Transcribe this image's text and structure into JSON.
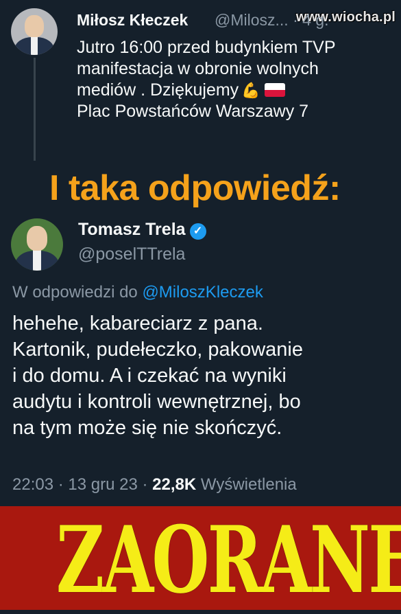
{
  "watermark": "www.wiocha.pl",
  "original_tweet": {
    "author_name": "Miłosz Kłeczek",
    "handle_truncated": "@Milosz... · 4 g.",
    "lines": [
      "Jutro 16:00 przed budynkiem TVP",
      "manifestacja w obronie wolnych",
      "mediów . Dziękujemy",
      "Plac Powstańców Warszawy 7"
    ],
    "emoji": "💪"
  },
  "overlay_heading": "I taka odpowiedź:",
  "reply_tweet": {
    "author_name": "Tomasz Trela",
    "verified_mark": "✓",
    "handle": "@poselTTrela",
    "reply_prefix": "W odpowiedzi do",
    "reply_mention": "@MiloszKleczek",
    "lines": [
      "hehehe, kabareciarz z pana.",
      "Kartonik, pudełeczko, pakowanie",
      "i do domu. A i czekać na wyniki",
      "audytu i kontroli wewnętrznej, bo",
      "na tym może się nie skończyć."
    ],
    "time": "22:03",
    "date": "13 gru 23",
    "separator": "·",
    "views_count": "22,8K",
    "views_label": "Wyświetlenia"
  },
  "banner": {
    "text": "ZAORANE",
    "background": "#a9180f",
    "color": "#f5ec17"
  },
  "colors": {
    "background": "#15202b",
    "accent": "#1d9bf0",
    "overlay": "#f5a21b",
    "muted": "#8b98a5"
  }
}
